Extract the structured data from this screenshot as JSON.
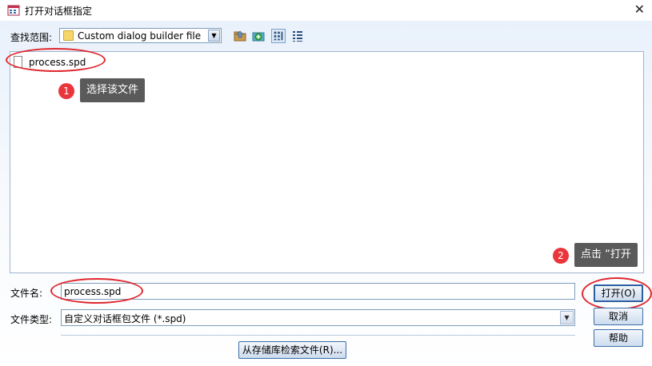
{
  "window": {
    "title": "打开对话框指定",
    "close_glyph": "✕"
  },
  "lookin": {
    "label": "查找范围:",
    "value": "Custom dialog builder file",
    "toolbar": [
      "up-folder-icon",
      "new-folder-icon",
      "list-view-icon",
      "details-view-icon"
    ]
  },
  "files": [
    {
      "name": "process.spd",
      "icon": "file-icon"
    }
  ],
  "annotations": [
    {
      "number": "1",
      "text": "选择该文件"
    },
    {
      "number": "2",
      "text": "点击 “打开"
    }
  ],
  "filename": {
    "label": "文件名:",
    "value": "process.spd"
  },
  "filetype": {
    "label": "文件类型:",
    "value": "自定义对话框包文件 (*.spd)"
  },
  "buttons": {
    "open": "打开(O)",
    "cancel": "取消",
    "help": "帮助",
    "repo": "从存储库检索文件(R)..."
  },
  "colors": {
    "accent": "#2b5fa0",
    "highlight_ring": "#e0282f",
    "tooltip_bg": "#5a5a5a"
  }
}
